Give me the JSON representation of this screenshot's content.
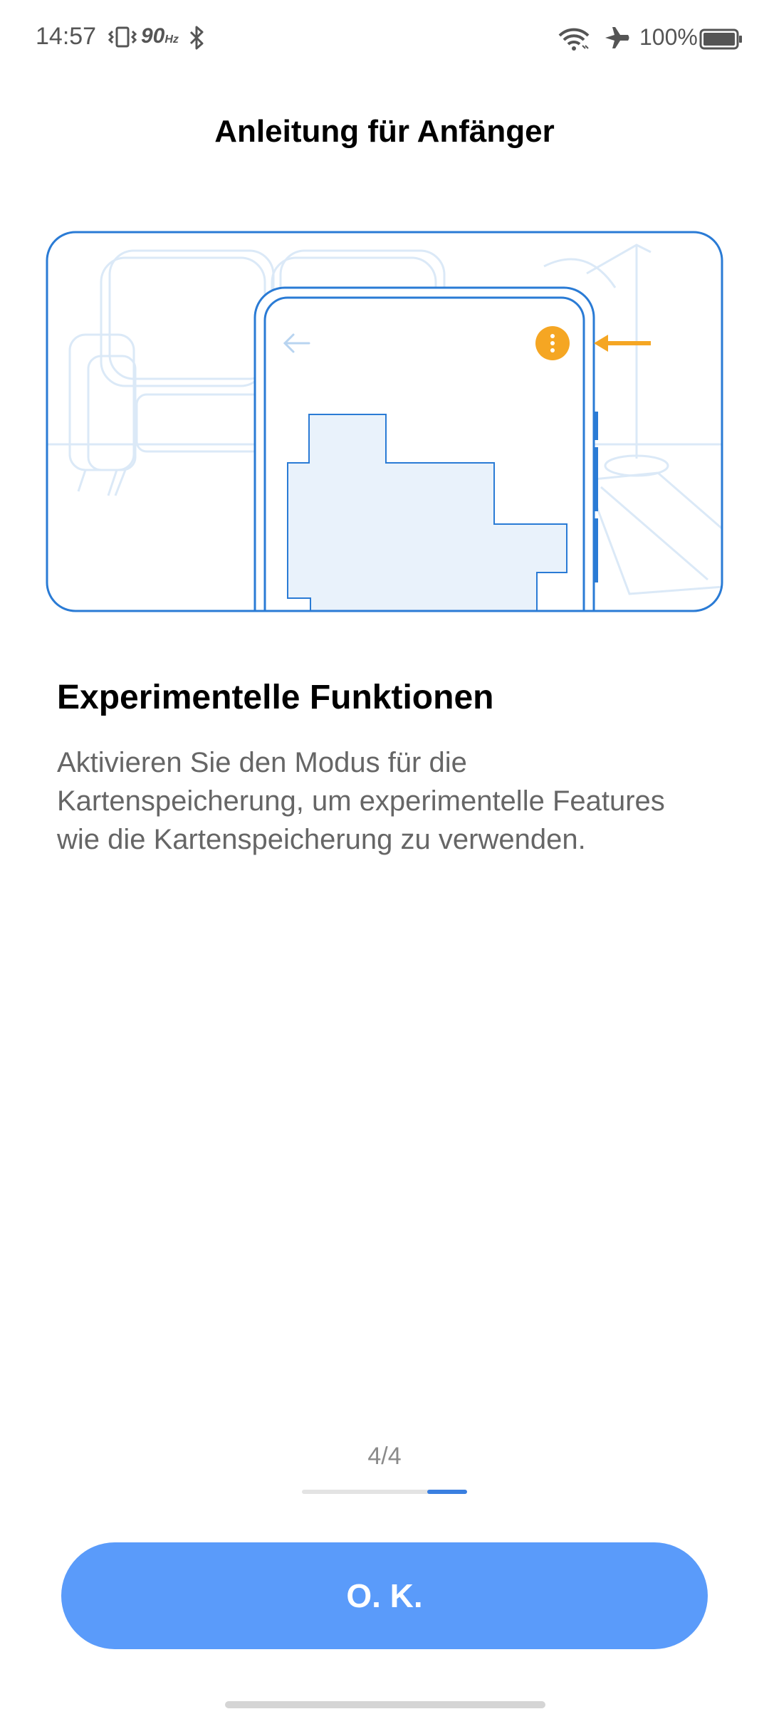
{
  "status_bar": {
    "time": "14:57",
    "refresh_rate": "90",
    "refresh_rate_unit": "Hz",
    "battery": "100%",
    "icons": [
      "vibrate-icon",
      "bluetooth-icon",
      "wifi-icon",
      "airplane-mode-icon",
      "battery-icon"
    ]
  },
  "page": {
    "title": "Anleitung für Anfänger"
  },
  "illustration": {
    "icons": [
      "back-arrow-icon",
      "more-options-icon",
      "pointer-arrow-icon"
    ],
    "colors": {
      "accent": "#f5a623",
      "line": "#2a7bd5",
      "map_fill": "#e9f2fb",
      "background_line": "#dbe9f7"
    }
  },
  "content": {
    "heading": "Experimentelle Funktionen",
    "body": "Aktivieren Sie den Modus für die Kartenspeicherung, um experimentelle Features wie die Kartenspeicherung zu verwenden."
  },
  "pager": {
    "text": "4/4",
    "current": 4,
    "total": 4
  },
  "ok_button": {
    "label": "O. K.",
    "color": "#5a9bfa"
  }
}
